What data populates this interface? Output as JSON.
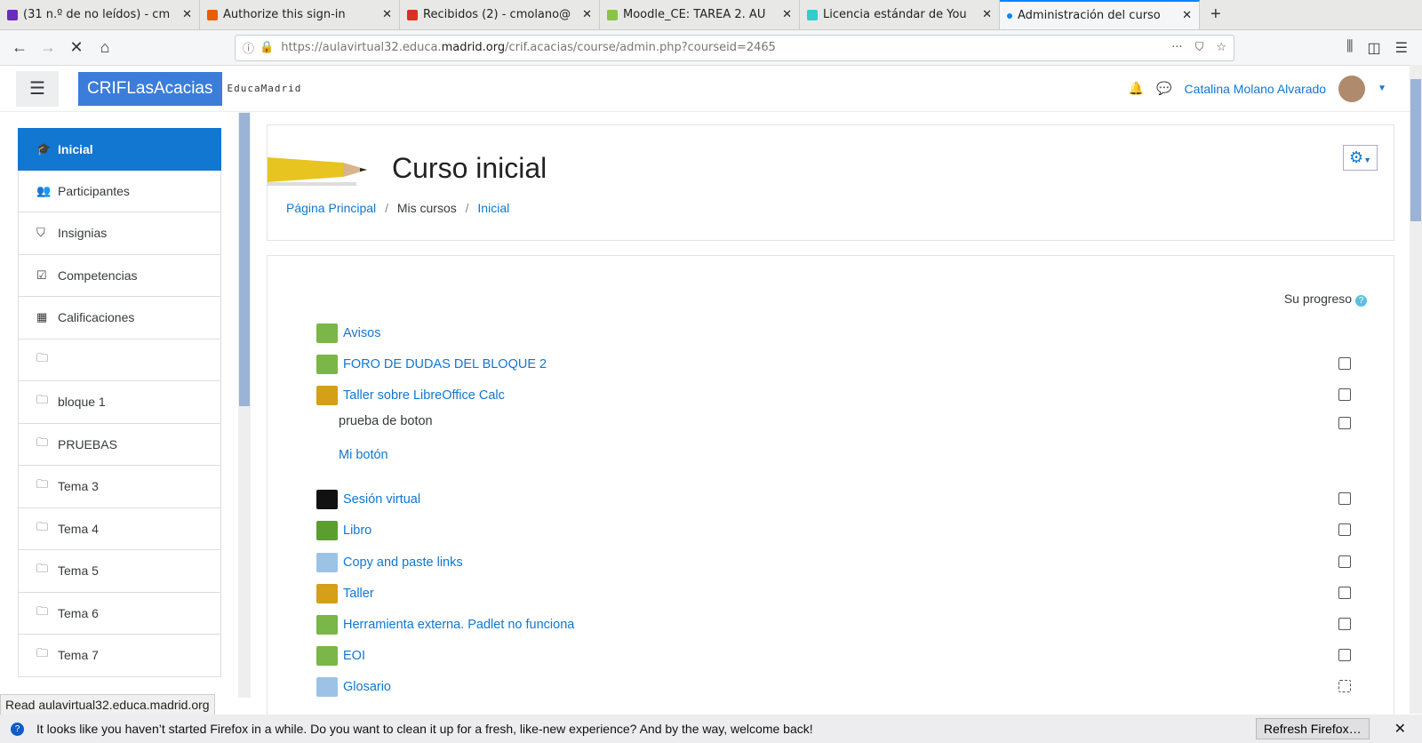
{
  "browser": {
    "tabs": [
      {
        "label": "(31 n.º de no leídos) - cm",
        "icon": "mail-icon",
        "color": "#6a2cbd"
      },
      {
        "label": "Authorize this sign-in",
        "icon": "firefox-icon",
        "color": "#e66000"
      },
      {
        "label": "Recibidos (2) - cmolano@",
        "icon": "gmail-icon",
        "color": "#d93025"
      },
      {
        "label": "Moodle_CE: TAREA 2. AU",
        "icon": "moodle-icon",
        "color": "#8bc34a"
      },
      {
        "label": "Licencia estándar de You",
        "icon": "pin-icon",
        "color": "#3cc"
      },
      {
        "label": "Administración del curso",
        "icon": "dot-icon",
        "color": "#0a84ff"
      }
    ],
    "url_prefix": "https://aulavirtual32.educa.",
    "url_domain": "madrid.org",
    "url_path": "/crif.acacias/course/admin.php?courseid=2465",
    "status_text": "Read aulavirtual32.educa.madrid.org",
    "notification": "It looks like you haven’t started Firefox in a while. Do you want to clean it up for a fresh, like-new experience? And by the way, welcome back!",
    "refresh_label": "Refresh Firefox…"
  },
  "header": {
    "brand": "CRIFLasAcacias",
    "logo": "EducaMadrid",
    "user": "Catalina Molano Alvarado"
  },
  "sidebar": [
    {
      "label": "Inicial",
      "icon": "🎓",
      "active": true
    },
    {
      "label": "Participantes",
      "icon": "👥"
    },
    {
      "label": "Insignias",
      "icon": "⛉"
    },
    {
      "label": "Competencias",
      "icon": "☑"
    },
    {
      "label": "Calificaciones",
      "icon": "▦"
    },
    {
      "label": "",
      "icon": "🗀"
    },
    {
      "label": "bloque 1",
      "icon": "🗀"
    },
    {
      "label": "PRUEBAS",
      "icon": "🗀"
    },
    {
      "label": "Tema 3",
      "icon": "🗀"
    },
    {
      "label": "Tema 4",
      "icon": "🗀"
    },
    {
      "label": "Tema 5",
      "icon": "🗀"
    },
    {
      "label": "Tema 6",
      "icon": "🗀"
    },
    {
      "label": "Tema 7",
      "icon": "🗀"
    }
  ],
  "course": {
    "title": "Curso inicial",
    "breadcrumb": [
      "Página Principal",
      "Mis cursos",
      "Inicial"
    ],
    "progress_label": "Su progreso",
    "activities": [
      {
        "label": "Avisos",
        "icon": "forum-icon",
        "color": "#7ab648",
        "check": false
      },
      {
        "label": "FORO DE DUDAS DEL BLOQUE 2",
        "icon": "forum-icon",
        "color": "#7ab648",
        "check": true
      },
      {
        "label": "Taller sobre LibreOffice Calc",
        "icon": "workshop-icon",
        "color": "#d4a017",
        "check": true
      },
      {
        "label": "prueba de boton",
        "icon": "",
        "color": "",
        "check": true,
        "plain": true
      },
      {
        "label": "Mi botón",
        "icon": "",
        "color": "",
        "check": false,
        "link_only": true
      },
      {
        "label": "Sesión virtual",
        "icon": "h5p-icon",
        "color": "#111",
        "check": true
      },
      {
        "label": "Libro",
        "icon": "book-icon",
        "color": "#5a9e2f",
        "check": true
      },
      {
        "label": "Copy and paste links",
        "icon": "page-icon",
        "color": "#9cc3e6",
        "check": true
      },
      {
        "label": "Taller",
        "icon": "workshop-icon",
        "color": "#d4a017",
        "check": true
      },
      {
        "label": "Herramienta externa. Padlet no funciona",
        "icon": "lti-icon",
        "color": "#7ab648",
        "check": true
      },
      {
        "label": "EOI",
        "icon": "lti-icon",
        "color": "#7ab648",
        "check": true
      },
      {
        "label": "Glosario",
        "icon": "glossary-icon",
        "color": "#9cc3e6",
        "check": true
      }
    ]
  }
}
